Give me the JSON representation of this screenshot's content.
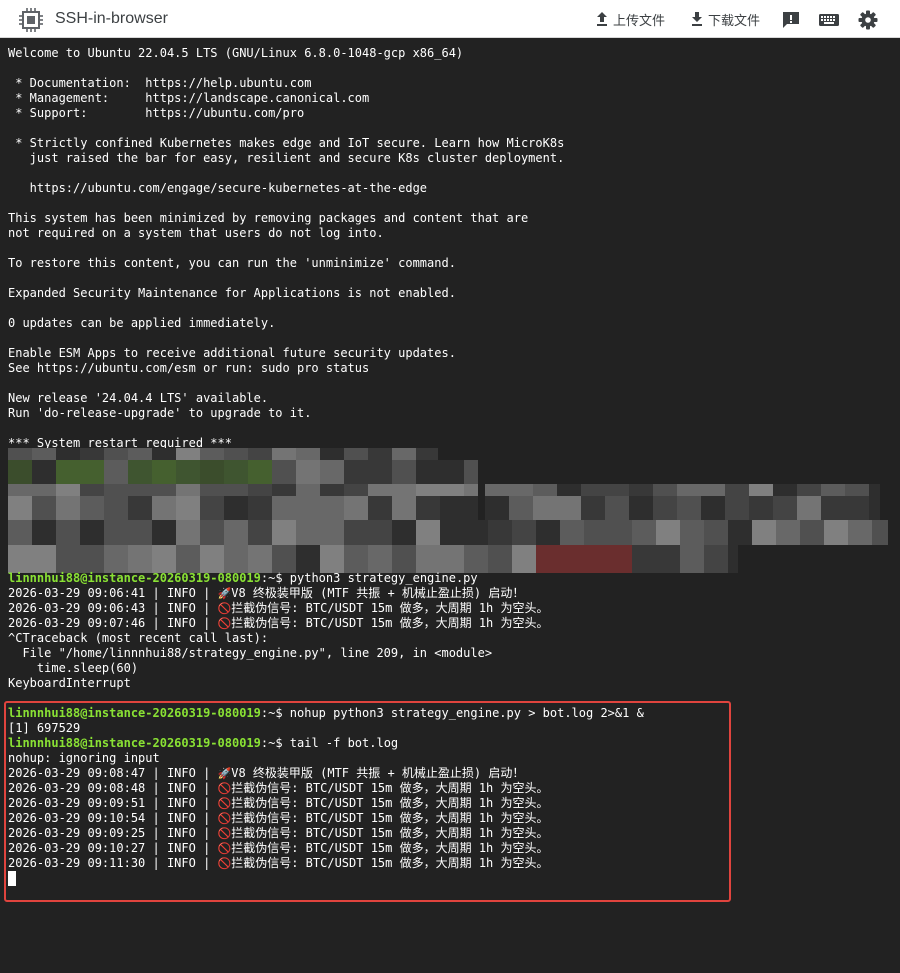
{
  "app": {
    "title": "SSH-in-browser",
    "upload_label": "上传文件",
    "download_label": "下载文件"
  },
  "terminal": {
    "motd": [
      "Welcome to Ubuntu 22.04.5 LTS (GNU/Linux 6.8.0-1048-gcp x86_64)",
      "",
      " * Documentation:  https://help.ubuntu.com",
      " * Management:     https://landscape.canonical.com",
      " * Support:        https://ubuntu.com/pro",
      "",
      " * Strictly confined Kubernetes makes edge and IoT secure. Learn how MicroK8s",
      "   just raised the bar for easy, resilient and secure K8s cluster deployment.",
      "",
      "   https://ubuntu.com/engage/secure-kubernetes-at-the-edge",
      "",
      "This system has been minimized by removing packages and content that are",
      "not required on a system that users do not log into.",
      "",
      "To restore this content, you can run the 'unminimize' command.",
      "",
      "Expanded Security Maintenance for Applications is not enabled.",
      "",
      "0 updates can be applied immediately.",
      "",
      "Enable ESM Apps to receive additional future security updates.",
      "See https://ubuntu.com/esm or run: sudo pro status",
      "",
      "New release '24.04.4 LTS' available.",
      "Run 'do-release-upgrade' to upgrade to it.",
      "",
      "*** System restart required ***"
    ],
    "prompt": "linnnhui88@instance-20260319-080019",
    "prompt_suffix": ":~$ ",
    "cmd_run": "python3 strategy_engine.py",
    "cmd_nohup": "nohup python3 strategy_engine.py > bot.log 2>&1 &",
    "cmd_tail": "tail -f bot.log",
    "job_line": "[1] 697529",
    "nohup_line": "nohup: ignoring input",
    "traceback": [
      "^CTraceback (most recent call last):",
      "  File \"/home/linnnhui88/strategy_engine.py\", line 209, in <module>",
      "    time.sleep(60)",
      "KeyboardInterrupt"
    ],
    "log_start_text": "V8 终极装甲版 (MTF 共振 + 机械止盈止损) 启动！",
    "log_block_text": "拦截伪信号: BTC/USDT 15m 做多，大周期 1h 为空头。",
    "log_level_sep": " | INFO | ",
    "rocket_glyph": "🚀",
    "block_glyph": "🚫",
    "run1_logs": [
      {
        "ts": "2026-03-29 09:06:41",
        "kind": "start"
      },
      {
        "ts": "2026-03-29 09:06:43",
        "kind": "block"
      },
      {
        "ts": "2026-03-29 09:07:46",
        "kind": "block"
      }
    ],
    "run2_logs": [
      {
        "ts": "2026-03-29 09:08:47",
        "kind": "start"
      },
      {
        "ts": "2026-03-29 09:08:48",
        "kind": "block"
      },
      {
        "ts": "2026-03-29 09:09:51",
        "kind": "block"
      },
      {
        "ts": "2026-03-29 09:10:54",
        "kind": "block"
      },
      {
        "ts": "2026-03-29 09:09:25",
        "kind": "block"
      },
      {
        "ts": "2026-03-29 09:10:27",
        "kind": "block"
      },
      {
        "ts": "2026-03-29 09:11:30",
        "kind": "block"
      }
    ]
  },
  "colors": {
    "terminal_bg": "#222222",
    "terminal_fg": "#ffffff",
    "prompt_green": "#8ae234",
    "highlight_red": "#e0443e"
  },
  "icons": {
    "logo": "chip-icon",
    "upload": "upload-icon",
    "download": "download-icon",
    "feedback": "feedback-icon",
    "keyboard": "keyboard-icon",
    "settings": "gear-icon"
  }
}
